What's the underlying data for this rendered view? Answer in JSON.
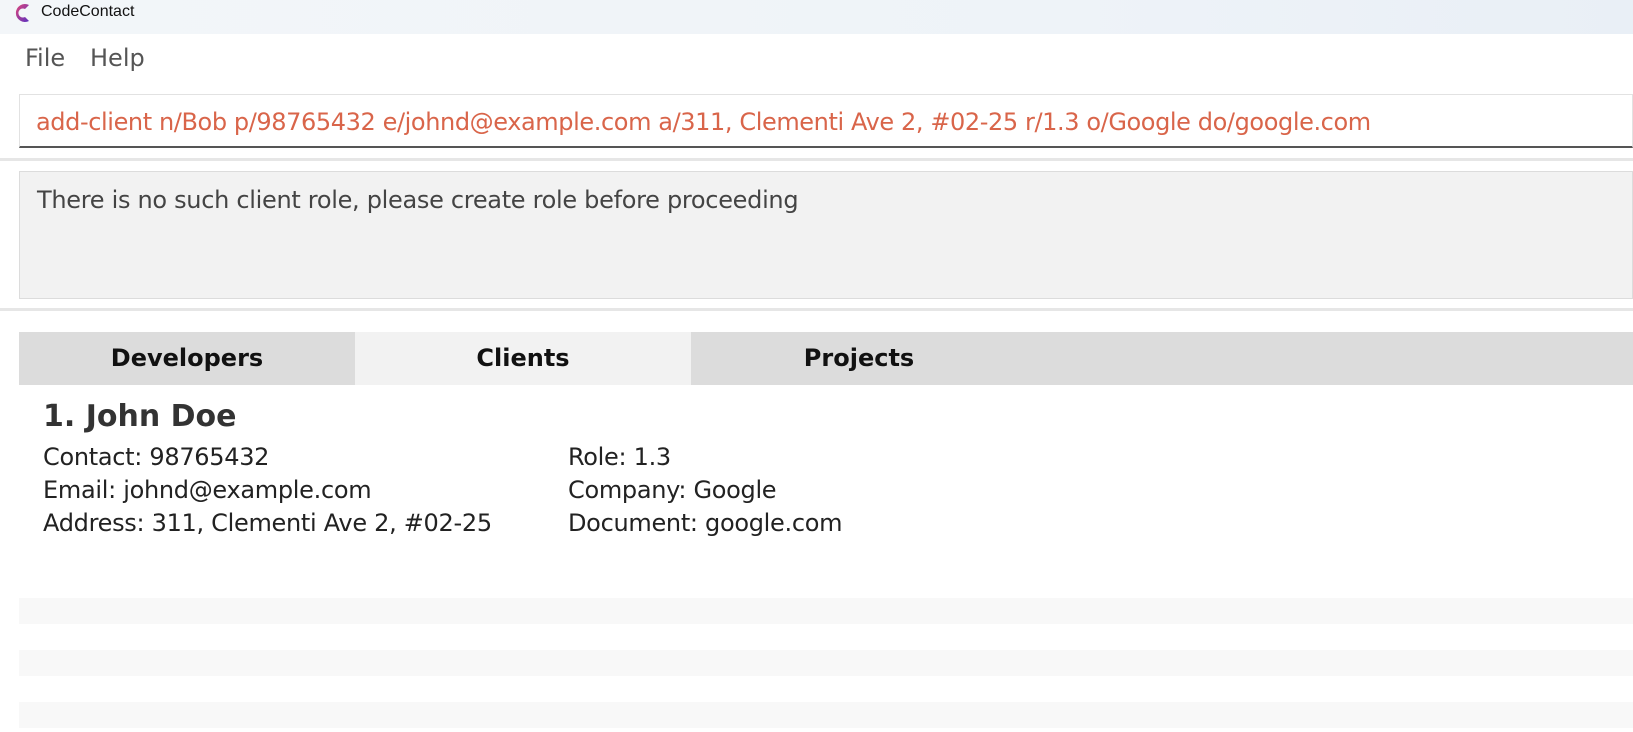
{
  "window": {
    "title": "CodeContact"
  },
  "menu": {
    "file": "File",
    "help": "Help"
  },
  "command": {
    "value": "add-client n/Bob p/98765432 e/johnd@example.com a/311, Clementi Ave 2, #02-25 r/1.3 o/Google do/google.com"
  },
  "result": {
    "message": "There is no such client role, please create role before proceeding"
  },
  "tabs": [
    {
      "label": "Developers"
    },
    {
      "label": "Clients"
    },
    {
      "label": "Projects"
    }
  ],
  "clients": [
    {
      "index_name": "1.  John Doe",
      "contact": "Contact: 98765432",
      "email": "Email: johnd@example.com",
      "address": "Address: 311, Clementi Ave 2, #02-25",
      "role": "Role: 1.3",
      "company": "Company: Google",
      "document": "Document: google.com"
    }
  ],
  "colors": {
    "command_text": "#d9654a",
    "tab_active": "#f2f2f2",
    "tab_inactive": "#dcdcdc",
    "logo_primary": "#7b3fd6",
    "logo_accent": "#e0477a"
  },
  "icons": {
    "app_logo": "codecontact-logo-icon"
  }
}
